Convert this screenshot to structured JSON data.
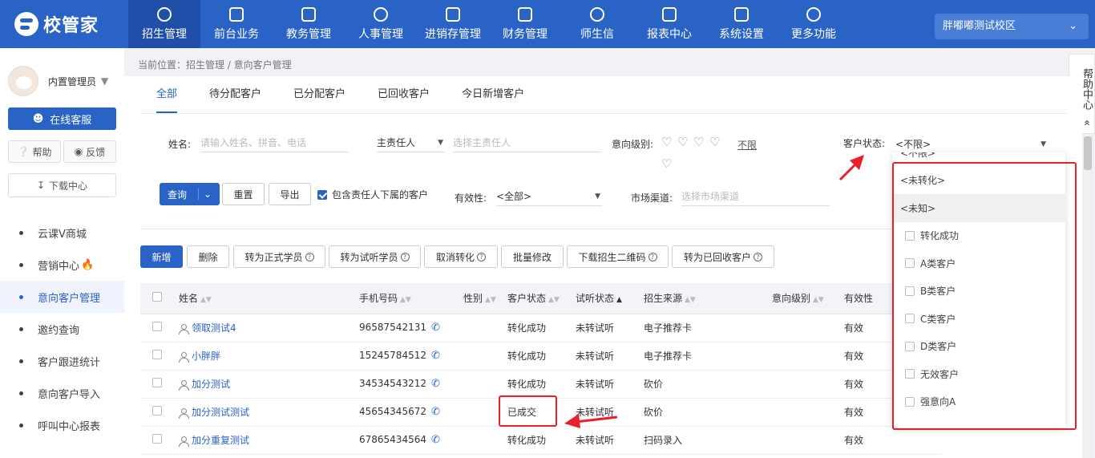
{
  "app": {
    "logo_text": "校管家",
    "campus": "胖嘟嘟测试校区"
  },
  "nav": [
    {
      "label": "招生管理",
      "icon": "user-plus-icon",
      "active": true
    },
    {
      "label": "前台业务",
      "icon": "desk-icon"
    },
    {
      "label": "教务管理",
      "icon": "book-icon"
    },
    {
      "label": "人事管理",
      "icon": "person-icon"
    },
    {
      "label": "进销存管理",
      "icon": "inventory-icon"
    },
    {
      "label": "财务管理",
      "icon": "yen-icon"
    },
    {
      "label": "师生信",
      "icon": "chat-icon"
    },
    {
      "label": "报表中心",
      "icon": "chart-icon"
    },
    {
      "label": "系统设置",
      "icon": "gear-icon"
    },
    {
      "label": "更多功能",
      "icon": "more-icon"
    }
  ],
  "sidebar": {
    "user_name": "内置管理员",
    "kefu": "在线客服",
    "help": "帮助",
    "feedback": "反馈",
    "download": "下载中心",
    "menu": [
      "云课V商城",
      "营销中心",
      "意向客户管理",
      "邀约查询",
      "客户跟进统计",
      "意向客户导入",
      "呼叫中心报表"
    ]
  },
  "breadcrumb": "当前位置：招生管理 / 意向客户管理",
  "help_center": "帮助中心",
  "tabs": [
    "全部",
    "待分配客户",
    "已分配客户",
    "已回收客户",
    "今日新增客户"
  ],
  "filters": {
    "name_label": "姓名:",
    "name_placeholder": "请输入姓名、拼音、电话",
    "owner_select": "主责任人",
    "owner_placeholder": "选择主责任人",
    "intent_label": "意向级别:",
    "intent_unlimited": "不限",
    "status_label": "客户状态:",
    "status_value": "<不限>",
    "valid_label": "有效性:",
    "valid_value": "<全部>",
    "channel_label": "市场渠道:",
    "channel_placeholder": "选择市场渠道",
    "include_sub": "包含责任人下属的客户"
  },
  "actions": {
    "query": "查询",
    "reset": "重置",
    "export": "导出",
    "add": "新增",
    "delete": "删除",
    "to_formal": "转为正式学员",
    "to_trial": "转为试听学员",
    "cancel_convert": "取消转化",
    "batch_edit": "批量修改",
    "download_qr": "下载招生二维码",
    "to_recycled": "转为已回收客户"
  },
  "table": {
    "headers": [
      "姓名",
      "手机号码",
      "性别",
      "客户状态",
      "试听状态",
      "招生来源",
      "意向级别",
      "有效性"
    ],
    "rows": [
      {
        "name": "领取测试4",
        "phone": "96587542131",
        "gender": "",
        "status": "转化成功",
        "trial": "未转试听",
        "source": "电子推荐卡",
        "level": "",
        "valid": "有效"
      },
      {
        "name": "小胖胖",
        "phone": "15245784512",
        "gender": "",
        "status": "转化成功",
        "trial": "未转试听",
        "source": "电子推荐卡",
        "level": "",
        "valid": "有效"
      },
      {
        "name": "加分测试",
        "phone": "34534543212",
        "gender": "",
        "status": "转化成功",
        "trial": "未转试听",
        "source": "砍价",
        "level": "",
        "valid": "有效"
      },
      {
        "name": "加分测试测试",
        "phone": "45654345672",
        "gender": "",
        "status": "已成交",
        "trial": "未转试听",
        "source": "砍价",
        "level": "",
        "valid": "有效"
      },
      {
        "name": "加分重复测试",
        "phone": "67865434564",
        "gender": "",
        "status": "转化成功",
        "trial": "未转试听",
        "source": "扫码录入",
        "level": "",
        "valid": "有效"
      }
    ]
  },
  "status_dropdown": [
    {
      "label": "<不限>",
      "checkbox": false
    },
    {
      "label": "<未转化>",
      "checkbox": false
    },
    {
      "label": "<未知>",
      "checkbox": false,
      "highlighted": true
    },
    {
      "label": "转化成功",
      "checkbox": true
    },
    {
      "label": "A类客户",
      "checkbox": true
    },
    {
      "label": "B类客户",
      "checkbox": true
    },
    {
      "label": "C类客户",
      "checkbox": true
    },
    {
      "label": "D类客户",
      "checkbox": true
    },
    {
      "label": "无效客户",
      "checkbox": true
    },
    {
      "label": "强意向A",
      "checkbox": true
    }
  ],
  "colors": {
    "brand": "#2a63c6",
    "annotation": "#e8202a"
  }
}
